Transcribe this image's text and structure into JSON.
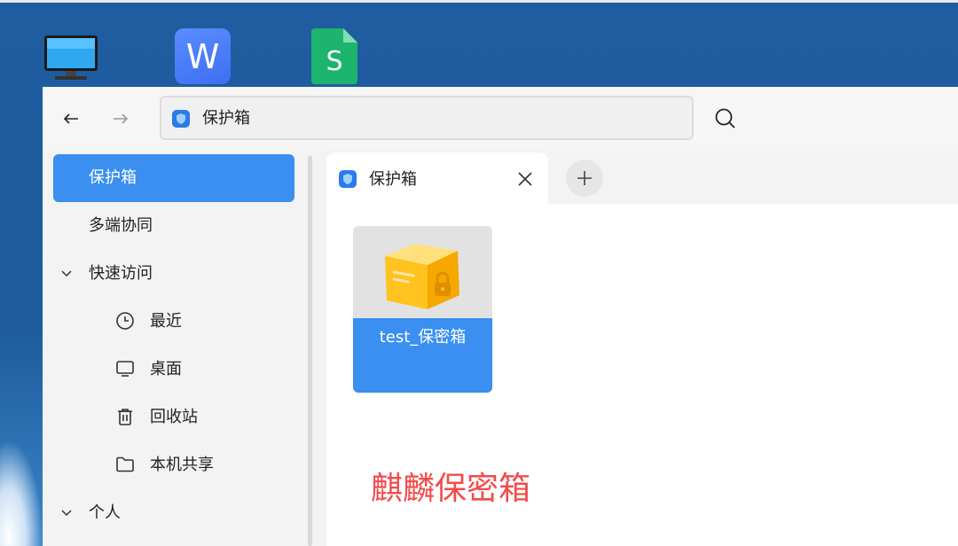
{
  "desktop": {
    "icons": [
      "computer-icon",
      "wps-writer-icon",
      "wps-spreadsheet-icon"
    ],
    "wps_writer_letter": "W",
    "wps_sheet_letter": "S"
  },
  "toolbar": {
    "address": "保护箱"
  },
  "sidebar": {
    "items": [
      {
        "label": "保护箱",
        "active": true
      },
      {
        "label": "多端协同"
      },
      {
        "label": "快速访问",
        "expandable": true
      },
      {
        "label": "最近",
        "icon": "clock-icon"
      },
      {
        "label": "桌面",
        "icon": "monitor-icon"
      },
      {
        "label": "回收站",
        "icon": "trash-icon"
      },
      {
        "label": "本机共享",
        "icon": "folder-icon"
      },
      {
        "label": "个人",
        "expandable": true
      }
    ]
  },
  "tabs": [
    {
      "label": "保护箱",
      "close": "×"
    }
  ],
  "files": [
    {
      "name": "test_保密箱"
    }
  ],
  "caption": "麒麟保密箱",
  "colors": {
    "accent": "#3a8ff0",
    "caption": "#f24b4b"
  }
}
